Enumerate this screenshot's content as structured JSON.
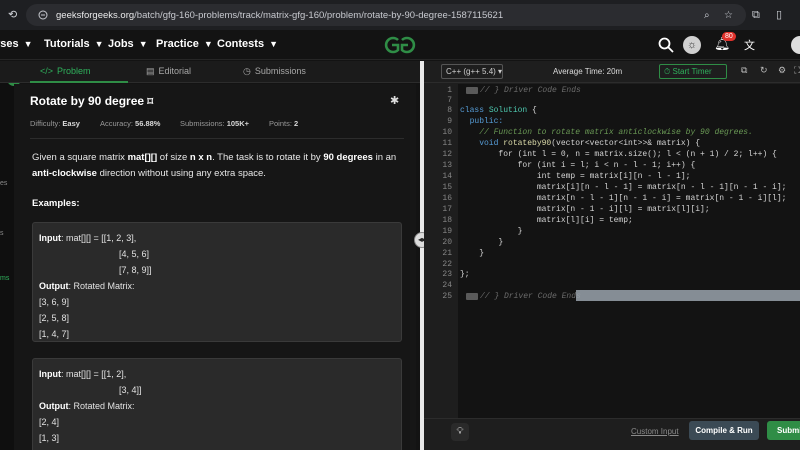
{
  "browser": {
    "url_domain": "geeksforgeeks.org",
    "url_path": "/batch/gfg-160-problems/track/matrix-gfg-160/problem/rotate-by-90-degree-1587115621"
  },
  "nav": {
    "items": [
      "rses",
      "Tutorials",
      "Jobs",
      "Practice",
      "Contests"
    ],
    "notif_count": "80",
    "logo_color": "#2f8d46"
  },
  "tabs": [
    "Problem",
    "Editorial",
    "Submissions"
  ],
  "problem": {
    "title": "Rotate by 90 degree",
    "difficulty_label": "Difficulty:",
    "difficulty": "Easy",
    "accuracy_label": "Accuracy:",
    "accuracy": "56.88%",
    "submissions_label": "Submissions:",
    "submissions": "105K+",
    "points_label": "Points:",
    "points": "2",
    "desc_1": "Given a square matrix ",
    "desc_mat": "mat[][]",
    "desc_2": " of size ",
    "desc_nxn": "n x n",
    "desc_3": ". The task is to rotate it by ",
    "desc_90": "90 degrees",
    "desc_4": " in an ",
    "desc_acw": "anti-clockwise",
    "desc_5": " direction without using any extra space.",
    "examples_label": "Examples:",
    "input_label": "Input",
    "output_label": "Output",
    "ex1_input": [
      ": mat[][] = [[1, 2, 3],",
      "[4, 5, 6]",
      "[7, 8, 9]]"
    ],
    "ex1_output_caption": ": Rotated Matrix:",
    "ex1_output": [
      "[3, 6, 9]",
      "[2, 5, 8]",
      "[1, 4, 7]"
    ],
    "ex2_input": [
      ": mat[][] = [[1, 2],",
      "[3, 4]]"
    ],
    "ex2_output_caption": ": Rotated Matrix:",
    "ex2_output": [
      "[2, 4]",
      "[1, 3]"
    ]
  },
  "left_rail": [
    "es",
    "s",
    "ms"
  ],
  "editor": {
    "language": "C++ (g++ 5.4)",
    "avg_time": "Average Time: 20m",
    "timer_label": "Start Timer",
    "line_numbers": [
      "1",
      "7",
      "8",
      "9",
      "10",
      "11",
      "12",
      "13",
      "14",
      "15",
      "16",
      "17",
      "18",
      "19",
      "20",
      "21",
      "22",
      "23",
      "24",
      "25"
    ],
    "code": {
      "l1": "// } Driver Code Ends",
      "l8a": "class ",
      "l8b": "Solution",
      "l8c": " {",
      "l9": "  public:",
      "l10": "    // Function to rotate matrix anticlockwise by 90 degrees.",
      "l11a": "    void ",
      "l11b": "rotateby90",
      "l11c": "(vector<vector<int>>& matrix) {",
      "l12": "        for (int l = 0, n = matrix.size(); l < (n + 1) / 2; l++) {",
      "l13": "            for (int i = l; i < n - l - 1; i++) {",
      "l14": "                int temp = matrix[i][n - l - 1];",
      "l15": "                matrix[i][n - l - 1] = matrix[n - l - 1][n - 1 - i];",
      "l16": "                matrix[n - l - 1][n - 1 - i] = matrix[n - 1 - i][l];",
      "l17": "                matrix[n - 1 - i][l] = matrix[l][i];",
      "l18": "                matrix[l][i] = temp;",
      "l19": "            }",
      "l20": "        }",
      "l21": "    }",
      "l22": "",
      "l23": "};",
      "l24": "",
      "l25": "// } Driver Code Ends"
    }
  },
  "footer": {
    "custom_input": "Custom Input",
    "compile_run": "Compile & Run",
    "submit": "Submit"
  }
}
